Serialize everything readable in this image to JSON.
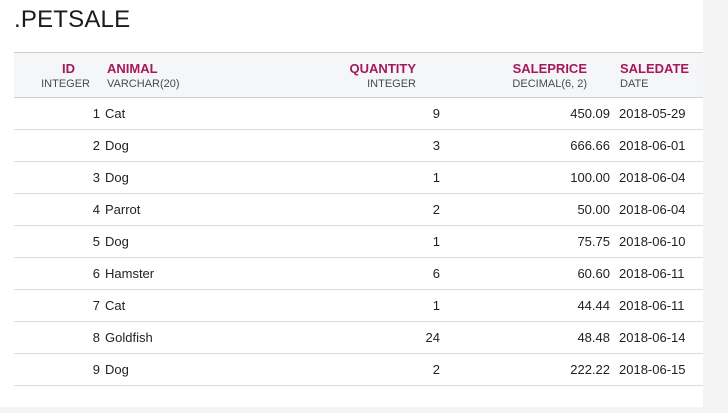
{
  "title": ".PETSALE",
  "columns": [
    {
      "name": "ID",
      "type": "INTEGER"
    },
    {
      "name": "ANIMAL",
      "type": "VARCHAR(20)"
    },
    {
      "name": "QUANTITY",
      "type": "INTEGER"
    },
    {
      "name": "SALEPRICE",
      "type": "DECIMAL(6, 2)"
    },
    {
      "name": "SALEDATE",
      "type": "DATE"
    }
  ],
  "rows": [
    [
      "1",
      "Cat",
      "9",
      "450.09",
      "2018-05-29"
    ],
    [
      "2",
      "Dog",
      "3",
      "666.66",
      "2018-06-01"
    ],
    [
      "3",
      "Dog",
      "1",
      "100.00",
      "2018-06-04"
    ],
    [
      "4",
      "Parrot",
      "2",
      "50.00",
      "2018-06-04"
    ],
    [
      "5",
      "Dog",
      "1",
      "75.75",
      "2018-06-10"
    ],
    [
      "6",
      "Hamster",
      "6",
      "60.60",
      "2018-06-11"
    ],
    [
      "7",
      "Cat",
      "1",
      "44.44",
      "2018-06-11"
    ],
    [
      "8",
      "Goldfish",
      "24",
      "48.48",
      "2018-06-14"
    ],
    [
      "9",
      "Dog",
      "2",
      "222.22",
      "2018-06-15"
    ]
  ]
}
